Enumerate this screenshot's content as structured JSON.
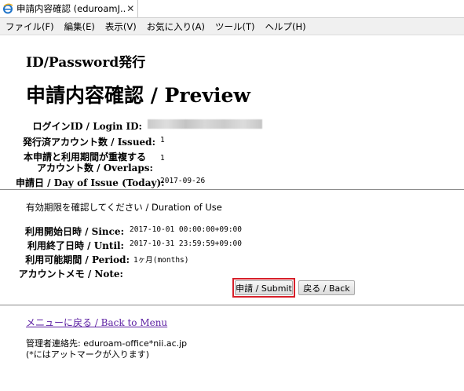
{
  "tab": {
    "title": "申請内容確認 (eduroamJ...",
    "close": "✕",
    "icon": "ie-icon"
  },
  "menubar": [
    "ファイル(F)",
    "編集(E)",
    "表示(V)",
    "お気に入り(A)",
    "ツール(T)",
    "ヘルプ(H)"
  ],
  "page": {
    "app_title": "ID/Password発行",
    "title": "申請内容確認 / Preview"
  },
  "summary": {
    "login_id_label": "ログインID / Login ID:",
    "issued_label": "発行済アカウント数 / Issued:",
    "issued_value": "1",
    "overlaps_label_line1": "本申請と利用期間が重複する",
    "overlaps_label_line2": "アカウント数 / Overlaps:",
    "overlaps_value": "1",
    "issue_date_label": "申請日 / Day of Issue (Today):",
    "issue_date_value": "2017-09-26"
  },
  "duration": {
    "prompt": "有効期限を確認してください / Duration of Use",
    "since_label": "利用開始日時 / Since:",
    "since_value": "2017-10-01 00:00:00+09:00",
    "until_label": "利用終了日時 / Until:",
    "until_value": "2017-10-31 23:59:59+09:00",
    "period_label": "利用可能期間 / Period:",
    "period_value": "1ヶ月(months)",
    "note_label": "アカウントメモ / Note:"
  },
  "buttons": {
    "submit": "申請 / Submit",
    "back": "戻る / Back"
  },
  "footer": {
    "menu_link": "メニューに戻る / Back to Menu",
    "contact_line1": "管理者連絡先: eduroam-office*nii.ac.jp",
    "contact_line2": "(*にはアットマークが入ります)"
  },
  "colors": {
    "highlight": "#d6202a",
    "link": "#5b1ea2"
  }
}
